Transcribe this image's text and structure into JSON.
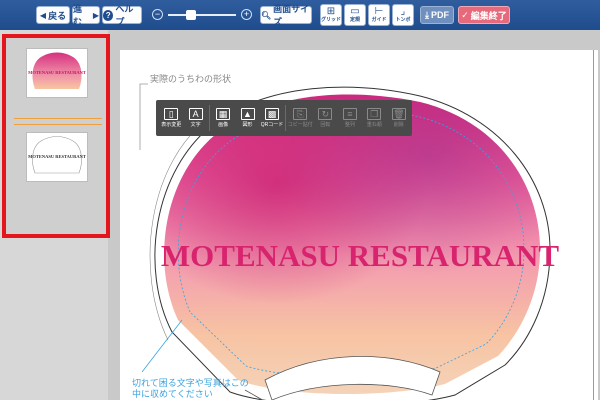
{
  "toolbar": {
    "back_label": "戻る",
    "forward_label": "進む",
    "help_label": "ヘルプ",
    "screen_size_label": "画面サイズ",
    "grid_label": "グリッド",
    "ruler_label": "定規",
    "guide_label": "ガイド",
    "tombo_label": "トンボ",
    "pdf_label": "PDF",
    "finish_label": "編集終了"
  },
  "floating_toolbar": {
    "items": [
      {
        "label": "表示変更",
        "enabled": true
      },
      {
        "label": "文字",
        "enabled": true
      },
      {
        "label": "画像",
        "enabled": true
      },
      {
        "label": "図形",
        "enabled": true
      },
      {
        "label": "QRコード",
        "enabled": true
      },
      {
        "label": "コピー貼付",
        "enabled": false
      },
      {
        "label": "回転",
        "enabled": false
      },
      {
        "label": "整列",
        "enabled": false
      },
      {
        "label": "重ね順",
        "enabled": false
      },
      {
        "label": "削除",
        "enabled": false
      }
    ]
  },
  "canvas": {
    "shape_label": "実際のうちわの形状",
    "main_title": "MOTENASU RESTAURANT",
    "guide_note": "切れて困る文字や写真はこの中に収めてください"
  },
  "pages": {
    "thumb1_title": "MOTENASU RESTAURANT",
    "thumb2_title": "MOTENASU RESTAURANT"
  },
  "colors": {
    "title": "#d8246e",
    "guide": "#3aa3e0",
    "highlight_border": "#e3161e",
    "toolbar": "#2f5d9e"
  }
}
